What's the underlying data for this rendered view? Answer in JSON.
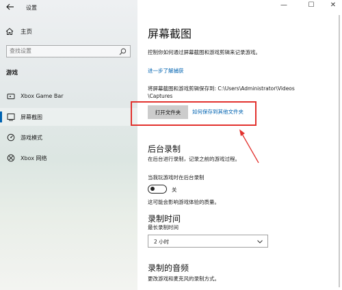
{
  "window": {
    "title": "设置",
    "back_icon": "back-arrow-icon",
    "controls": {
      "minimize": "—",
      "maximize": "☐",
      "close": "✕"
    }
  },
  "sidebar": {
    "home_label": "主页",
    "search_placeholder": "查找设置",
    "section_label": "游戏",
    "items": [
      {
        "label": "Xbox Game Bar",
        "icon": "xbox-game-bar-icon"
      },
      {
        "label": "屏幕截图",
        "icon": "capture-icon",
        "active": true
      },
      {
        "label": "游戏模式",
        "icon": "game-mode-icon"
      },
      {
        "label": "Xbox 网络",
        "icon": "xbox-icon"
      }
    ]
  },
  "main": {
    "title": "屏幕截图",
    "description": "控制你如何通过屏幕截图和游戏剪辑来记录游戏。",
    "learn_more": "进一步了解捕获",
    "save_path_line1": "将屏幕截图和游戏剪辑保存到: C:\\Users\\Administrator\\Videos",
    "save_path_line2": "\\Captures",
    "open_folder_button": "打开文件夹",
    "save_other_link": "如何保存到其他文件夹",
    "background_recording": {
      "heading": "后台录制",
      "description": "在后台进行录制，记录之前的游戏过程。",
      "toggle_caption": "当我玩游戏时在后台录制",
      "toggle_state": "关",
      "note": "这可能会影响游戏体验的质量。"
    },
    "record_time": {
      "heading": "录制时间",
      "label": "最长录制时间",
      "selected": "2 小时"
    },
    "audio": {
      "heading": "录制的音频",
      "description": "更改游戏和麦克风的录制方式。"
    }
  },
  "colors": {
    "accent": "#0063b1",
    "highlight": "#e2312d"
  }
}
